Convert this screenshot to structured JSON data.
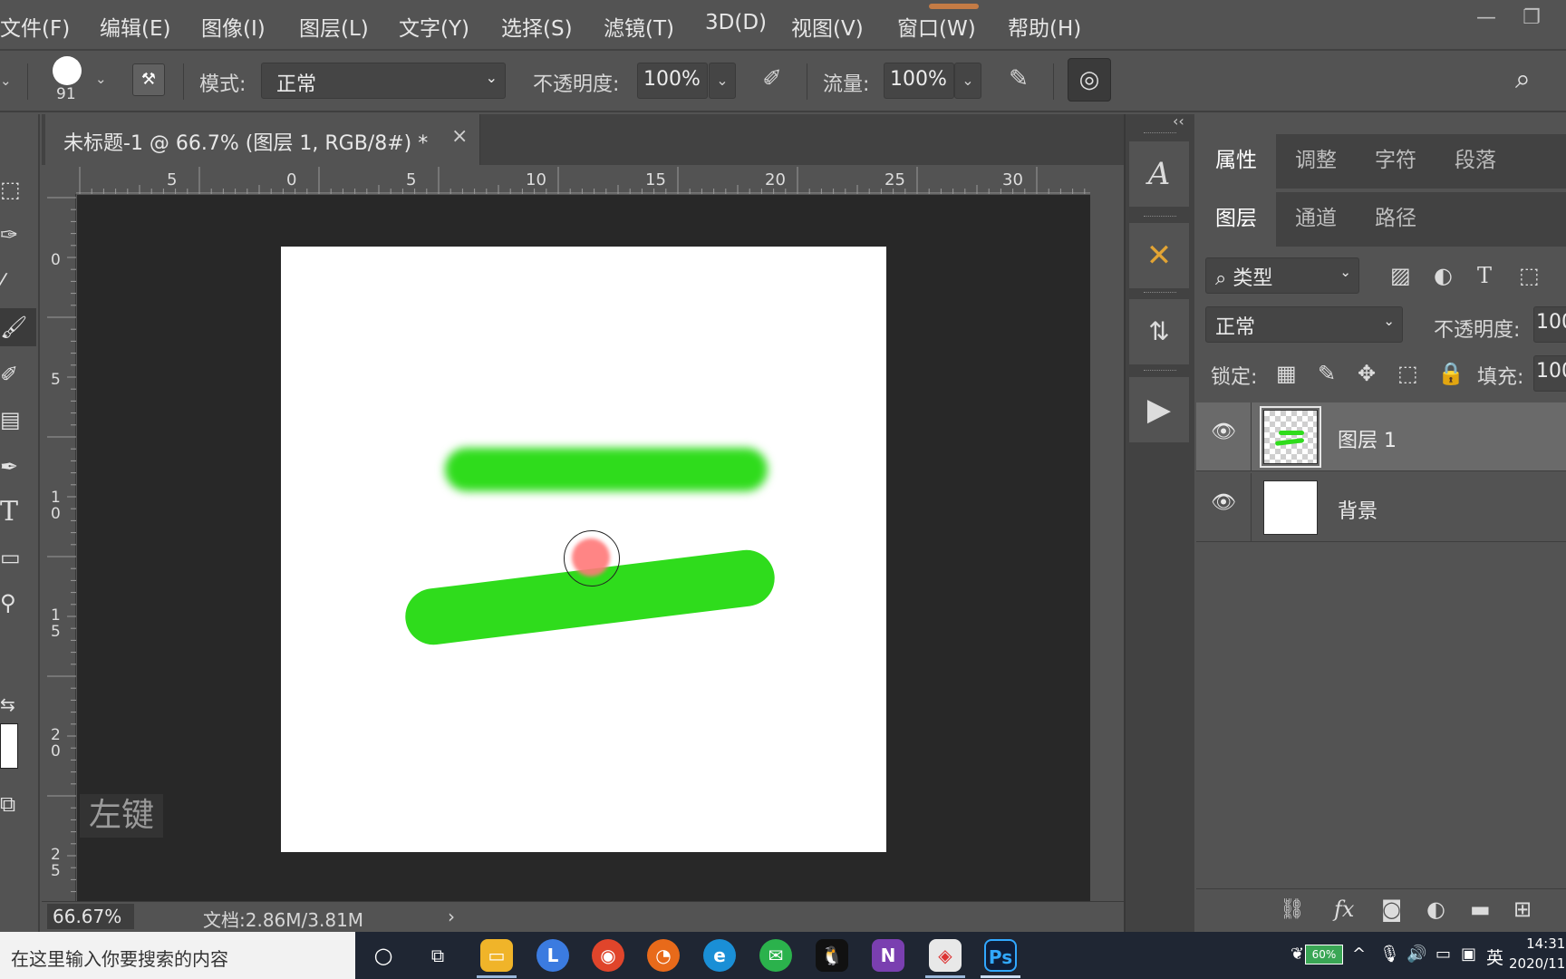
{
  "menubar": {
    "items": [
      "文件(F)",
      "编辑(E)",
      "图像(I)",
      "图层(L)",
      "文字(Y)",
      "选择(S)",
      "滤镜(T)",
      "3D(D)",
      "视图(V)",
      "窗口(W)",
      "帮助(H)"
    ]
  },
  "options": {
    "brush_size": "91",
    "mode_label": "模式:",
    "mode_value": "正常",
    "opacity_label": "不透明度:",
    "opacity_value": "100%",
    "flow_label": "流量:",
    "flow_value": "100%"
  },
  "document": {
    "tab_title": "未标题-1 @ 66.7% (图层 1, RGB/8#) *",
    "close": "×"
  },
  "ruler": {
    "h_labels": [
      "5",
      "0",
      "5",
      "10",
      "15",
      "20",
      "25",
      "30"
    ],
    "v_labels": [
      "0",
      "5",
      "1\n0",
      "1\n5",
      "2\n0",
      "2\n5"
    ]
  },
  "canvas": {
    "key_hint": "左键",
    "stroke_color": "#2fdc1c"
  },
  "status": {
    "zoom": "66.67%",
    "doc_info": "文档:2.86M/3.81M",
    "arrow": "›"
  },
  "panels": {
    "top_tabs": [
      "属性",
      "调整",
      "字符",
      "段落"
    ],
    "layer_tabs": [
      "图层",
      "通道",
      "路径"
    ],
    "filter_kind": "类型",
    "blend_mode": "正常",
    "opacity_label": "不透明度:",
    "opacity_value": "100",
    "lock_label": "锁定:",
    "fill_label": "填充:",
    "fill_value": "100",
    "layers": [
      {
        "name": "图层 1",
        "selected": true
      },
      {
        "name": "背景",
        "selected": false
      }
    ],
    "collapse": "‹‹"
  },
  "taskbar": {
    "search_placeholder": "在这里输入你要搜索的内容",
    "battery": "60%",
    "ime": "英",
    "time": "14:31",
    "date": "2020/11"
  }
}
